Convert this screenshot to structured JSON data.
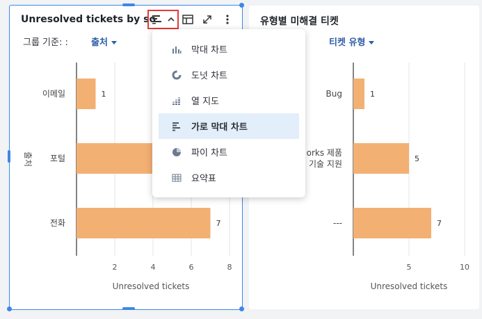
{
  "left_panel": {
    "title": "Unresolved tickets by source",
    "group_label": "그룹 기준: :",
    "group_value": "출처"
  },
  "right_panel": {
    "title": "유형별 미해결 티켓",
    "group_label": ":",
    "group_value": "티켓 유형"
  },
  "chart_type_menu": {
    "items": [
      {
        "label": "막대 차트",
        "icon": "bar-chart-icon"
      },
      {
        "label": "도넛 차트",
        "icon": "donut-chart-icon"
      },
      {
        "label": "열 지도",
        "icon": "heatmap-icon"
      },
      {
        "label": "가로 막대 차트",
        "icon": "horizontal-bar-chart-icon",
        "selected": true
      },
      {
        "label": "파이 차트",
        "icon": "pie-chart-icon"
      },
      {
        "label": "요약표",
        "icon": "summary-table-icon"
      }
    ]
  },
  "colors": {
    "bar": "#f3b073",
    "accent": "#3d86e8",
    "highlight_border": "#e53935"
  },
  "chart_data": [
    {
      "type": "bar",
      "orientation": "horizontal",
      "categories": [
        "이메일",
        "포털",
        "전화"
      ],
      "values": [
        1,
        7,
        7
      ],
      "xlabel": "Unresolved tickets",
      "ylabel": "출처",
      "xlim": [
        0,
        8
      ],
      "xticks": [
        2,
        4,
        6,
        8
      ],
      "grid": true
    },
    {
      "type": "bar",
      "orientation": "horizontal",
      "categories": [
        "Bug",
        "orks 제품\n기술 지원",
        "---"
      ],
      "values": [
        1,
        5,
        7
      ],
      "xlabel": "Unresolved tickets",
      "xlim": [
        0,
        10
      ],
      "xticks": [
        5,
        10
      ],
      "grid": true
    }
  ]
}
